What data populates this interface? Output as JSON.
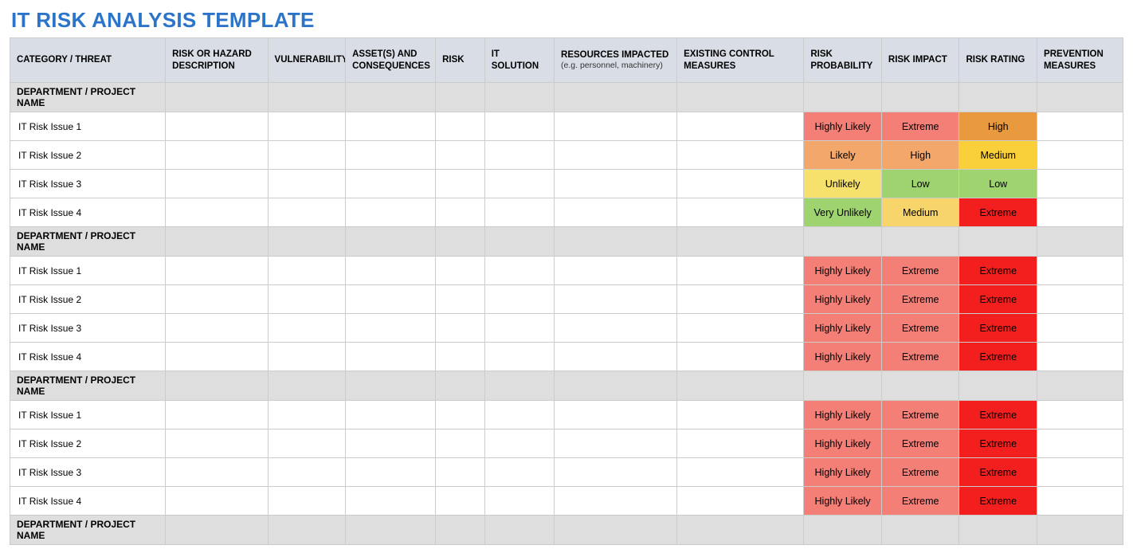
{
  "title": "IT RISK ANALYSIS TEMPLATE",
  "columns": [
    {
      "label": "CATEGORY / THREAT"
    },
    {
      "label": "RISK OR HAZARD DESCRIPTION"
    },
    {
      "label": "VULNERABILITY"
    },
    {
      "label": "ASSET(S) AND CONSEQUENCES"
    },
    {
      "label": "RISK"
    },
    {
      "label": "IT SOLUTION"
    },
    {
      "label": "RESOURCES IMPACTED",
      "sub": "(e.g. personnel, machinery)"
    },
    {
      "label": "EXISTING CONTROL MEASURES"
    },
    {
      "label": "RISK PROBABILITY"
    },
    {
      "label": "RISK IMPACT"
    },
    {
      "label": "RISK RATING"
    },
    {
      "label": "PREVENTION MEASURES"
    }
  ],
  "sections": [
    {
      "name": "DEPARTMENT / PROJECT NAME",
      "rows": [
        {
          "label": "IT Risk Issue 1",
          "prob": {
            "text": "Highly Likely",
            "cls": "c-highly-likely"
          },
          "impact": {
            "text": "Extreme",
            "cls": "c-extreme-soft"
          },
          "rating": {
            "text": "High",
            "cls": "c-high-orange"
          }
        },
        {
          "label": "IT Risk Issue 2",
          "prob": {
            "text": "Likely",
            "cls": "c-likely"
          },
          "impact": {
            "text": "High",
            "cls": "c-high-soft"
          },
          "rating": {
            "text": "Medium",
            "cls": "c-medium-yellow"
          }
        },
        {
          "label": "IT Risk Issue 3",
          "prob": {
            "text": "Unlikely",
            "cls": "c-unlikely"
          },
          "impact": {
            "text": "Low",
            "cls": "c-low-green"
          },
          "rating": {
            "text": "Low",
            "cls": "c-low-green"
          }
        },
        {
          "label": "IT Risk Issue 4",
          "prob": {
            "text": "Very Unlikely",
            "cls": "c-very-unlikely"
          },
          "impact": {
            "text": "Medium",
            "cls": "c-medium-soft"
          },
          "rating": {
            "text": "Extreme",
            "cls": "c-extreme-red"
          }
        }
      ]
    },
    {
      "name": "DEPARTMENT / PROJECT NAME",
      "rows": [
        {
          "label": "IT Risk Issue 1",
          "prob": {
            "text": "Highly Likely",
            "cls": "c-highly-likely"
          },
          "impact": {
            "text": "Extreme",
            "cls": "c-extreme-soft"
          },
          "rating": {
            "text": "Extreme",
            "cls": "c-extreme-red"
          }
        },
        {
          "label": "IT Risk Issue 2",
          "prob": {
            "text": "Highly Likely",
            "cls": "c-highly-likely"
          },
          "impact": {
            "text": "Extreme",
            "cls": "c-extreme-soft"
          },
          "rating": {
            "text": "Extreme",
            "cls": "c-extreme-red"
          }
        },
        {
          "label": "IT Risk Issue 3",
          "prob": {
            "text": "Highly Likely",
            "cls": "c-highly-likely"
          },
          "impact": {
            "text": "Extreme",
            "cls": "c-extreme-soft"
          },
          "rating": {
            "text": "Extreme",
            "cls": "c-extreme-red"
          }
        },
        {
          "label": "IT Risk Issue 4",
          "prob": {
            "text": "Highly Likely",
            "cls": "c-highly-likely"
          },
          "impact": {
            "text": "Extreme",
            "cls": "c-extreme-soft"
          },
          "rating": {
            "text": "Extreme",
            "cls": "c-extreme-red"
          }
        }
      ]
    },
    {
      "name": "DEPARTMENT / PROJECT NAME",
      "rows": [
        {
          "label": "IT Risk Issue 1",
          "prob": {
            "text": "Highly Likely",
            "cls": "c-highly-likely"
          },
          "impact": {
            "text": "Extreme",
            "cls": "c-extreme-soft"
          },
          "rating": {
            "text": "Extreme",
            "cls": "c-extreme-red"
          }
        },
        {
          "label": "IT Risk Issue 2",
          "prob": {
            "text": "Highly Likely",
            "cls": "c-highly-likely"
          },
          "impact": {
            "text": "Extreme",
            "cls": "c-extreme-soft"
          },
          "rating": {
            "text": "Extreme",
            "cls": "c-extreme-red"
          }
        },
        {
          "label": "IT Risk Issue 3",
          "prob": {
            "text": "Highly Likely",
            "cls": "c-highly-likely"
          },
          "impact": {
            "text": "Extreme",
            "cls": "c-extreme-soft"
          },
          "rating": {
            "text": "Extreme",
            "cls": "c-extreme-red"
          }
        },
        {
          "label": "IT Risk Issue 4",
          "prob": {
            "text": "Highly Likely",
            "cls": "c-highly-likely"
          },
          "impact": {
            "text": "Extreme",
            "cls": "c-extreme-soft"
          },
          "rating": {
            "text": "Extreme",
            "cls": "c-extreme-red"
          }
        }
      ]
    },
    {
      "name": "DEPARTMENT / PROJECT NAME",
      "rows": []
    }
  ]
}
